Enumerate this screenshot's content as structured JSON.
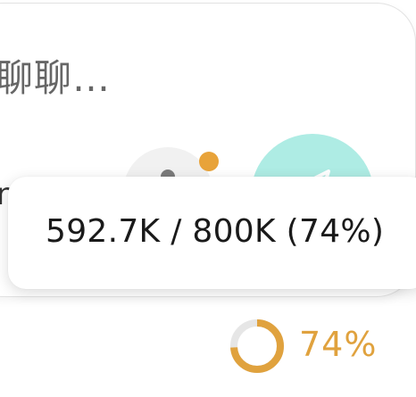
{
  "composer": {
    "placeholder_visible": "聊聊…",
    "left_glyph": "n"
  },
  "tooltip": {
    "usage_text": "592.7K / 800K (74%)"
  },
  "usage_indicator": {
    "percent_value": 0.74,
    "percent_label": "74%",
    "ring_color": "#e0a23e",
    "track_color": "#e6e6e6"
  },
  "colors": {
    "send_button": "#aeece4",
    "notification_dot": "#e8a33a",
    "mic_button": "#f1f1f1"
  },
  "icons": {
    "send": "send-icon",
    "mic": "mic-icon"
  }
}
